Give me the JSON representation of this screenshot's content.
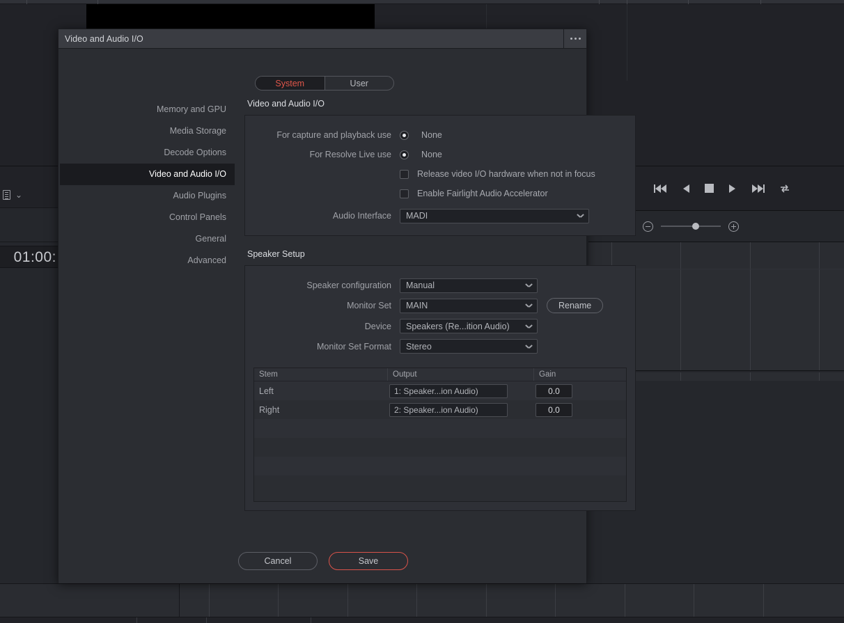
{
  "background": {
    "timecode": "01:00:",
    "menu_chevron_icon": "chevron-down-icon",
    "list_icon": "list-view-icon",
    "transport": {
      "prev_marker_icon": "chevron-left-icon",
      "marker_icon": "marker-dot-icon",
      "next_marker_icon": "chevron-right-icon",
      "buttons": [
        {
          "name": "jump-to-start-button",
          "icon": "skip-back-icon"
        },
        {
          "name": "play-reverse-button",
          "icon": "play-reverse-icon"
        },
        {
          "name": "stop-button",
          "icon": "stop-icon"
        },
        {
          "name": "play-button",
          "icon": "play-icon"
        },
        {
          "name": "jump-to-end-button",
          "icon": "skip-forward-icon"
        },
        {
          "name": "loop-button",
          "icon": "loop-icon"
        }
      ]
    },
    "zoombar": {
      "view_icon": "timeline-view-icon",
      "zoom_out_icon": "zoom-out-icon",
      "zoom_in_icon": "zoom-in-icon"
    }
  },
  "dialog": {
    "title": "Video and Audio I/O",
    "overflow_menu_icon": "more-options-icon",
    "tabs": {
      "items": [
        {
          "label": "System",
          "active": true
        },
        {
          "label": "User",
          "active": false
        }
      ],
      "active_color": "#e0564a"
    },
    "sidebar": {
      "items": [
        {
          "label": "Memory and GPU",
          "active": false
        },
        {
          "label": "Media Storage",
          "active": false
        },
        {
          "label": "Decode Options",
          "active": false
        },
        {
          "label": "Video and Audio I/O",
          "active": true
        },
        {
          "label": "Audio Plugins",
          "active": false
        },
        {
          "label": "Control Panels",
          "active": false
        },
        {
          "label": "General",
          "active": false
        },
        {
          "label": "Advanced",
          "active": false
        }
      ]
    },
    "io_section": {
      "title": "Video and Audio I/O",
      "capture_playback": {
        "label": "For capture and playback use",
        "value": "None",
        "selected": true
      },
      "resolve_live": {
        "label": "For Resolve Live use",
        "value": "None",
        "selected": true
      },
      "release_hardware": {
        "label": "Release video I/O hardware when not in focus",
        "checked": false
      },
      "fairlight_accelerator": {
        "label": "Enable Fairlight Audio Accelerator",
        "checked": false
      },
      "audio_interface": {
        "label": "Audio Interface",
        "value": "MADI"
      }
    },
    "speaker_section": {
      "title": "Speaker Setup",
      "speaker_configuration": {
        "label": "Speaker configuration",
        "value": "Manual"
      },
      "monitor_set": {
        "label": "Monitor Set",
        "value": "MAIN",
        "rename_label": "Rename"
      },
      "device": {
        "label": "Device",
        "value": "Speakers (Re...ition Audio)"
      },
      "monitor_set_format": {
        "label": "Monitor Set Format",
        "value": "Stereo"
      },
      "table": {
        "columns": [
          "Stem",
          "Output",
          "Gain"
        ],
        "rows": [
          {
            "stem": "Left",
            "output": "1: Speaker...ion Audio)",
            "gain": "0.0"
          },
          {
            "stem": "Right",
            "output": "2: Speaker...ion Audio)",
            "gain": "0.0"
          }
        ],
        "empty_rows": 4
      }
    },
    "footer": {
      "cancel_label": "Cancel",
      "save_label": "Save",
      "save_accent": "#d9534a"
    }
  }
}
